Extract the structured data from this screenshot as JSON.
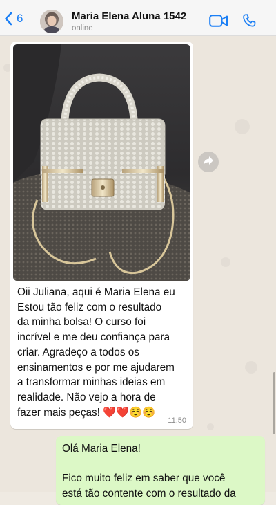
{
  "header": {
    "back_count": "6",
    "contact_name": "Maria Elena Aluna 1542",
    "status": "online"
  },
  "messages": [
    {
      "direction": "incoming",
      "has_photo": true,
      "text": "Oii Juliana, aqui é Maria Elena eu\nEstou tão feliz com o resultado\nda minha bolsa! O curso foi\nincrível e me deu confiança para\ncriar. Agradeço a todos os\nensinamentos e por me ajudarem\na transformar minhas ideias em\nrealidade. Não vejo a hora de\nfazer mais peças! ❤️❤️☺️☺️",
      "time": "11:50"
    },
    {
      "direction": "outgoing",
      "text": "Olá  Maria Elena!\n\nFico muito feliz em saber que você\nestá tão contente com o resultado da"
    }
  ],
  "icons": {
    "back": "chevron-left-icon",
    "video": "video-camera-icon",
    "call": "phone-icon",
    "forward": "forward-arrow-icon"
  },
  "colors": {
    "accent": "#1b7ff5",
    "incoming_bubble": "#ffffff",
    "outgoing_bubble": "#dcf8c6",
    "chat_background": "#ece6dd",
    "header_background": "#f6f6f6"
  }
}
